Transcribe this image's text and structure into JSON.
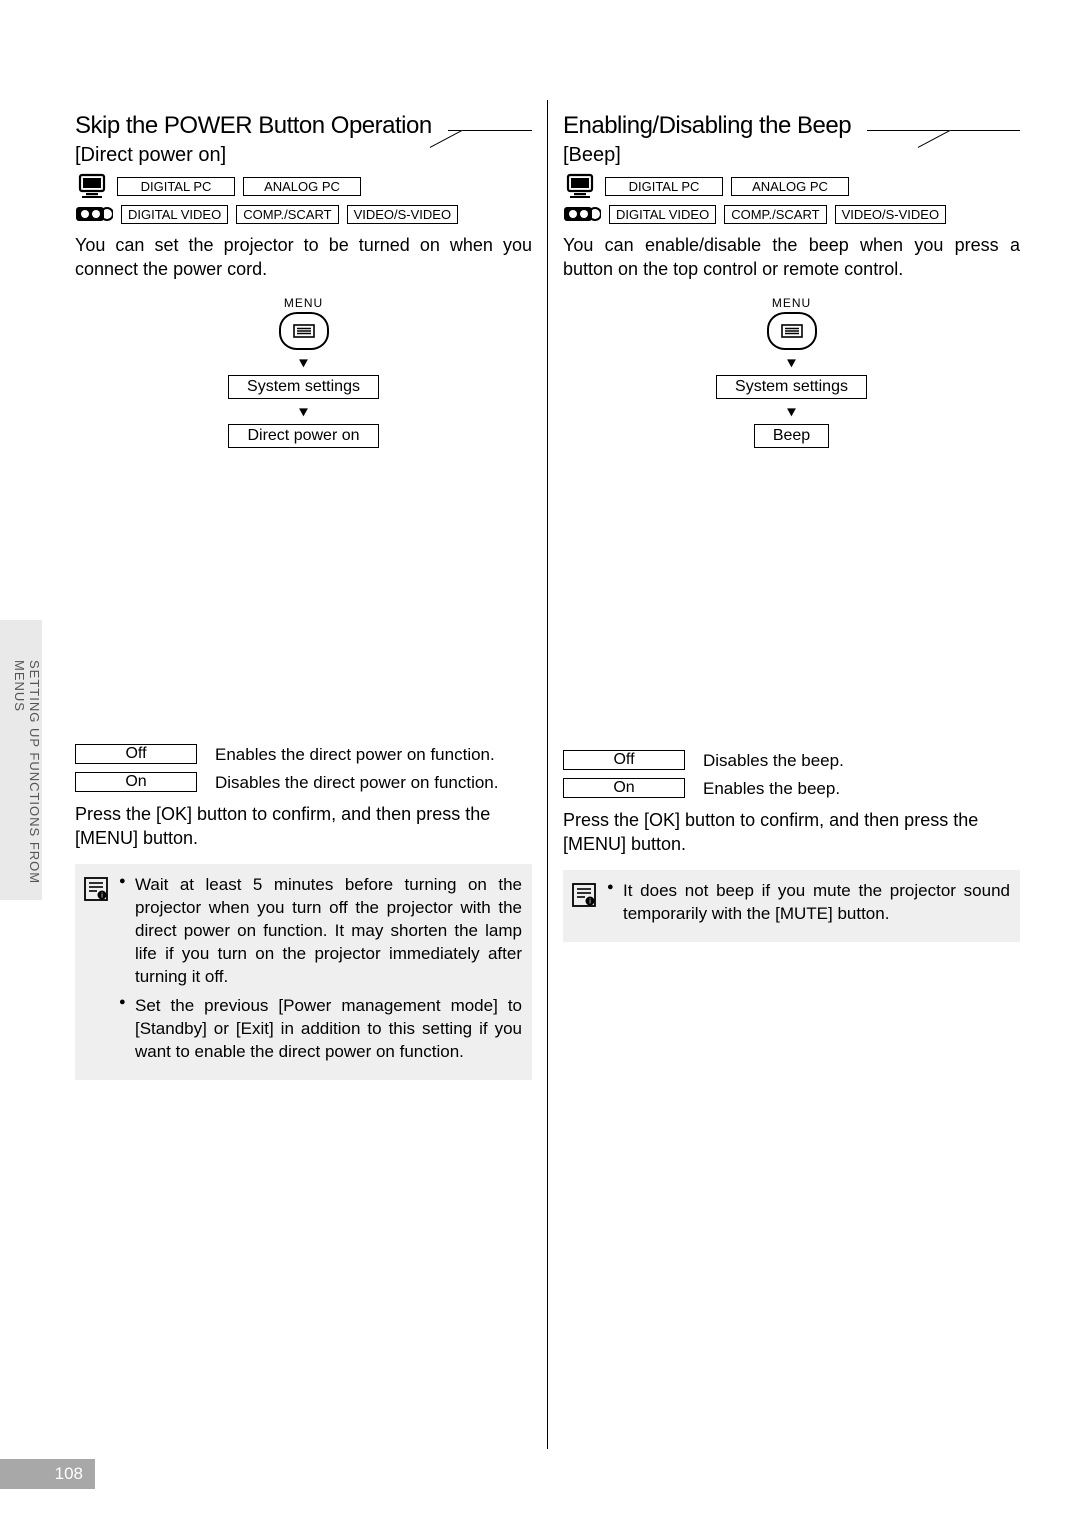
{
  "sidebar": {
    "label": "SETTING UP FUNCTIONS FROM MENUS"
  },
  "page_number": "108",
  "tags": {
    "digital_pc": "DIGITAL PC",
    "analog_pc": "ANALOG PC",
    "digital_video": "DIGITAL VIDEO",
    "comp_scart": "COMP./SCART",
    "video_svideo": "VIDEO/S-VIDEO"
  },
  "menu": {
    "label": "MENU",
    "system_settings": "System settings"
  },
  "left": {
    "heading": "Skip the POWER Button Operation",
    "subheading": "[Direct power on]",
    "body": "You can set the projector to be turned on when you connect the power cord.",
    "menu_target": "Direct power on",
    "options": [
      {
        "label": "Off",
        "desc": "Enables the direct power on function."
      },
      {
        "label": "On",
        "desc": "Disables the direct power on function."
      }
    ],
    "confirm": "Press the [OK] button to confirm, and then press the [MENU] button.",
    "notes": [
      "Wait at least 5 minutes before turning on the projector when you turn off the projector with the direct power on function. It may shorten the lamp life if you turn on the projector immediately after turning it off.",
      "Set the previous [Power management mode] to [Standby] or [Exit] in addition to this setting if you want to enable the direct power on function."
    ]
  },
  "right": {
    "heading": "Enabling/Disabling the Beep",
    "subheading": "[Beep]",
    "body": "You can enable/disable the beep when you press a button on the top control or remote control.",
    "menu_target": "Beep",
    "options": [
      {
        "label": "Off",
        "desc": "Disables the beep."
      },
      {
        "label": "On",
        "desc": "Enables the beep."
      }
    ],
    "confirm": "Press the [OK] button to confirm, and then press the [MENU] button.",
    "notes": [
      "It does not beep if you mute the projector sound temporarily with the [MUTE] button."
    ]
  }
}
